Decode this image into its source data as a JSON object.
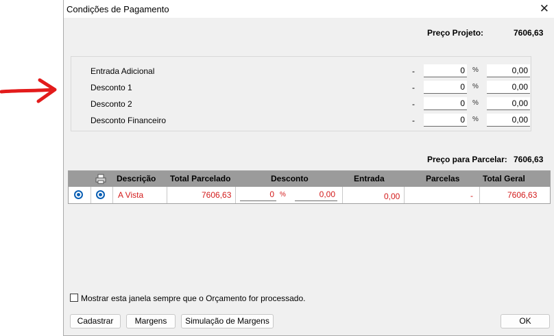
{
  "window": {
    "title": "Condições de Pagamento",
    "close": "✕"
  },
  "preco_projeto": {
    "label": "Preço Projeto:",
    "value": "7606,63"
  },
  "rows": [
    {
      "label": "Entrada Adicional",
      "dash": "-",
      "percent": "0",
      "pct_sign": "%",
      "value": "0,00"
    },
    {
      "label": "Desconto 1",
      "dash": "-",
      "percent": "0",
      "pct_sign": "%",
      "value": "0,00"
    },
    {
      "label": "Desconto 2",
      "dash": "-",
      "percent": "0",
      "pct_sign": "%",
      "value": "0,00"
    },
    {
      "label": "Desconto Financeiro",
      "dash": "-",
      "percent": "0",
      "pct_sign": "%",
      "value": "0,00"
    }
  ],
  "preco_parcelar": {
    "label": "Preço para Parcelar:",
    "value": "7606,63"
  },
  "grid": {
    "headers": [
      "Descrição",
      "Total Parcelado",
      "Desconto",
      "Entrada",
      "Parcelas",
      "Total Geral"
    ],
    "row": {
      "descricao": "A Vista",
      "total_parcelado": "7606,63",
      "desconto_pct": "0",
      "pct_sign": "%",
      "desconto_val": "0,00",
      "entrada": "0,00",
      "parcelas": "-",
      "total_geral": "7606,63"
    }
  },
  "checkbox_label": "Mostrar esta janela sempre que o Orçamento for processado.",
  "buttons": {
    "cadastrar": "Cadastrar",
    "margens": "Margens",
    "simulacao": "Simulação de Margens",
    "ok": "OK"
  },
  "colors": {
    "arrow": "#e31b1b",
    "accent_red": "#d31919",
    "header_gray": "#9b9b9b",
    "radio_blue": "#0a5fb4"
  }
}
